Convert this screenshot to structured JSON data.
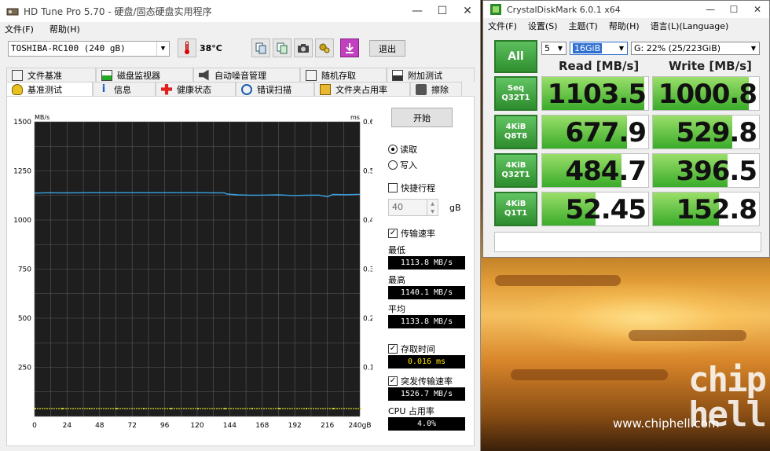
{
  "hdtune": {
    "title": "HD Tune Pro 5.70 - 硬盘/固态硬盘实用程序",
    "menu": [
      "文件(F)",
      "帮助(H)"
    ],
    "drive": "TOSHIBA-RC100 (240 gB)",
    "temperature": "38°C",
    "exit_label": "退出",
    "tabs_row1": [
      "文件基准",
      "磁盘监视器",
      "自动噪音管理",
      "随机存取",
      "附加测试"
    ],
    "tabs_row2": [
      "基准测试",
      "信息",
      "健康状态",
      "错误扫描",
      "文件夹占用率",
      "擦除"
    ],
    "start_label": "开始",
    "read_label": "读取",
    "write_label": "写入",
    "short_stroke_label": "快捷行程",
    "short_stroke_value": "40",
    "short_stroke_unit": "gB",
    "transfer_rate_label": "传输速率",
    "min_label": "最低",
    "min_value": "1113.8 MB/s",
    "max_label": "最高",
    "max_value": "1140.1 MB/s",
    "avg_label": "平均",
    "avg_value": "1133.8 MB/s",
    "access_time_label": "存取时间",
    "access_time_value": "0.016 ms",
    "burst_label": "突发传输速率",
    "burst_value": "1526.7 MB/s",
    "cpu_label": "CPU 占用率",
    "cpu_value": "4.0%",
    "colors": {
      "chart_bg": "#1e1e1e",
      "grid": "#5a5a5a",
      "transfer": "#3aa0e0",
      "access": "#d8d830"
    }
  },
  "chart_data": {
    "type": "line",
    "y_left_unit": "MB/s",
    "y_right_unit": "ms",
    "x_unit": "gB",
    "x_ticks": [
      "0",
      "24",
      "48",
      "72",
      "96",
      "120",
      "144",
      "168",
      "192",
      "216",
      "240gB"
    ],
    "y_left_ticks": [
      "1500",
      "1250",
      "1000",
      "750",
      "500",
      "250"
    ],
    "y_right_ticks": [
      "0.60",
      "0.50",
      "0.40",
      "0.30",
      "0.20",
      "0.10"
    ],
    "x_range": [
      0,
      240
    ],
    "y_left_range": [
      0,
      1500
    ],
    "y_right_range": [
      0,
      0.6
    ],
    "grid": true,
    "series": [
      {
        "name": "传输速率",
        "x": [
          0,
          10,
          20,
          40,
          60,
          80,
          100,
          120,
          140,
          142,
          150,
          160,
          170,
          180,
          190,
          200,
          210,
          216,
          220,
          230,
          240
        ],
        "y": [
          1137,
          1139,
          1138,
          1139,
          1139,
          1139,
          1139,
          1139,
          1138,
          1132,
          1128,
          1126,
          1127,
          1128,
          1125,
          1126,
          1127,
          1118,
          1130,
          1129,
          1131
        ]
      },
      {
        "name": "存取时间",
        "x": [
          0,
          20,
          40,
          60,
          80,
          100,
          120,
          140,
          160,
          180,
          200,
          220,
          240
        ],
        "y": [
          0.016,
          0.016,
          0.016,
          0.016,
          0.016,
          0.016,
          0.016,
          0.016,
          0.016,
          0.016,
          0.016,
          0.016,
          0.016
        ]
      }
    ]
  },
  "cdm": {
    "title": "CrystalDiskMark 6.0.1 x64",
    "menu": [
      "文件(F)",
      "设置(S)",
      "主题(T)",
      "帮助(H)",
      "语言(L)(Language)"
    ],
    "all_label": "All",
    "runs": "5",
    "size": "16GiB",
    "drive": "G: 22% (25/223GiB)",
    "read_header": "Read [MB/s]",
    "write_header": "Write [MB/s]",
    "rows": [
      {
        "line1": "Seq",
        "line2": "Q32T1",
        "read": "1103.5",
        "write": "1000.8",
        "read_fill": 0.96,
        "write_fill": 0.9
      },
      {
        "line1": "4KiB",
        "line2": "Q8T8",
        "read": "677.9",
        "write": "529.8",
        "read_fill": 0.8,
        "write_fill": 0.75
      },
      {
        "line1": "4KiB",
        "line2": "Q32T1",
        "read": "484.7",
        "write": "396.5",
        "read_fill": 0.75,
        "write_fill": 0.7
      },
      {
        "line1": "4KiB",
        "line2": "Q1T1",
        "read": "52.45",
        "write": "152.8",
        "read_fill": 0.5,
        "write_fill": 0.62
      }
    ]
  },
  "watermark": {
    "url": "www.chiphell.com",
    "logo": "chip hell"
  }
}
